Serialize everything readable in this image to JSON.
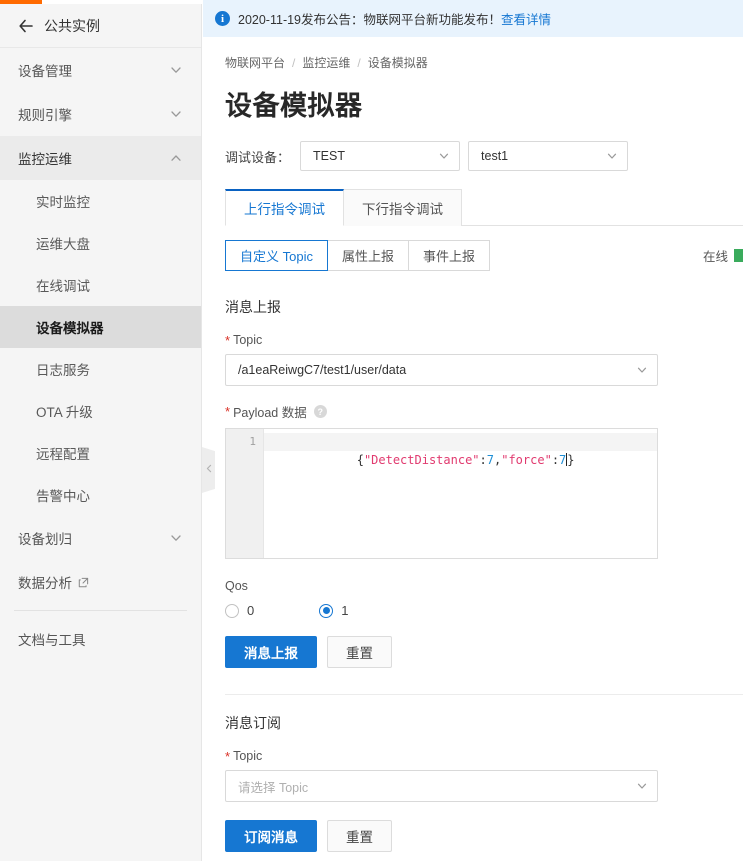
{
  "colors": {
    "accent_orange": "#ff6a00",
    "primary_blue": "#1677d2",
    "tab_blue": "#0a62c2",
    "required_red": "#d93026",
    "online_green": "#3aab5c",
    "string_token": "#e13a6f",
    "number_token": "#1f8fd6"
  },
  "sidebar": {
    "instance": {
      "back_icon": "arrow-left-icon",
      "label": "公共实例"
    },
    "groups": [
      {
        "label": "设备管理",
        "icon": "chevron-down-icon",
        "expanded": false,
        "active": false
      },
      {
        "label": "规则引擎",
        "icon": "chevron-down-icon",
        "expanded": false,
        "active": false
      },
      {
        "label": "监控运维",
        "icon": "chevron-up-icon",
        "expanded": true,
        "active": true
      }
    ],
    "children": [
      {
        "label": "实时监控",
        "selected": false
      },
      {
        "label": "运维大盘",
        "selected": false
      },
      {
        "label": "在线调试",
        "selected": false
      },
      {
        "label": "设备模拟器",
        "selected": true
      },
      {
        "label": "日志服务",
        "selected": false
      },
      {
        "label": "OTA 升级",
        "selected": false
      },
      {
        "label": "远程配置",
        "selected": false
      },
      {
        "label": "告警中心",
        "selected": false
      }
    ],
    "groups_after": [
      {
        "label": "设备划归",
        "icon": "chevron-down-icon",
        "expanded": false
      }
    ],
    "external_link": {
      "label": "数据分析",
      "icon": "external-link-icon"
    },
    "footer_item": {
      "label": "文档与工具"
    },
    "collapse_handle_icon": "chevron-left-icon"
  },
  "notice": {
    "icon": "info-circle-icon",
    "text": "2020-11-19发布公告：物联网平台新功能发布！",
    "link": "查看详情"
  },
  "breadcrumb": [
    {
      "label": "物联网平台"
    },
    {
      "label": "监控运维"
    },
    {
      "label": "设备模拟器"
    }
  ],
  "breadcrumb_separator": "/",
  "page_title": "设备模拟器",
  "device_selector": {
    "label": "调试设备：",
    "product": {
      "value": "TEST",
      "icon": "chevron-down-icon"
    },
    "device": {
      "value": "test1",
      "icon": "chevron-down-icon"
    }
  },
  "tabs": [
    {
      "label": "上行指令调试",
      "active": true
    },
    {
      "label": "下行指令调试",
      "active": false
    }
  ],
  "sub_tabs": [
    {
      "label": "自定义 Topic",
      "active": true
    },
    {
      "label": "属性上报",
      "active": false
    },
    {
      "label": "事件上报",
      "active": false
    }
  ],
  "status": {
    "label": "在线",
    "indicator": "online-dot"
  },
  "publish": {
    "section_title": "消息上报",
    "topic_label": "Topic",
    "topic_required": "*",
    "topic_value": "/a1eaReiwgC7/test1/user/data",
    "topic_chevron": "chevron-down-icon",
    "payload_label": "Payload 数据",
    "payload_required": "*",
    "payload_help_icon": "question-circle-icon",
    "payload_help_glyph": "?",
    "editor": {
      "line_number": "1",
      "tokens": [
        {
          "t": "{",
          "k": "pun"
        },
        {
          "t": "\"DetectDistance\"",
          "k": "str"
        },
        {
          "t": ":",
          "k": "pun"
        },
        {
          "t": "7",
          "k": "num"
        },
        {
          "t": ",",
          "k": "pun"
        },
        {
          "t": "\"force\"",
          "k": "str"
        },
        {
          "t": ":",
          "k": "pun"
        },
        {
          "t": "7",
          "k": "num"
        },
        {
          "t": "}",
          "k": "pun"
        }
      ],
      "raw": "{\"DetectDistance\":7,\"force\":7}"
    },
    "qos_label": "Qos",
    "qos_options": [
      {
        "label": "0",
        "checked": false
      },
      {
        "label": "1",
        "checked": true
      }
    ],
    "submit_label": "消息上报",
    "reset_label": "重置"
  },
  "subscribe": {
    "section_title": "消息订阅",
    "topic_label": "Topic",
    "topic_required": "*",
    "topic_placeholder": "请选择 Topic",
    "topic_chevron": "chevron-down-icon",
    "submit_label": "订阅消息",
    "reset_label": "重置"
  }
}
